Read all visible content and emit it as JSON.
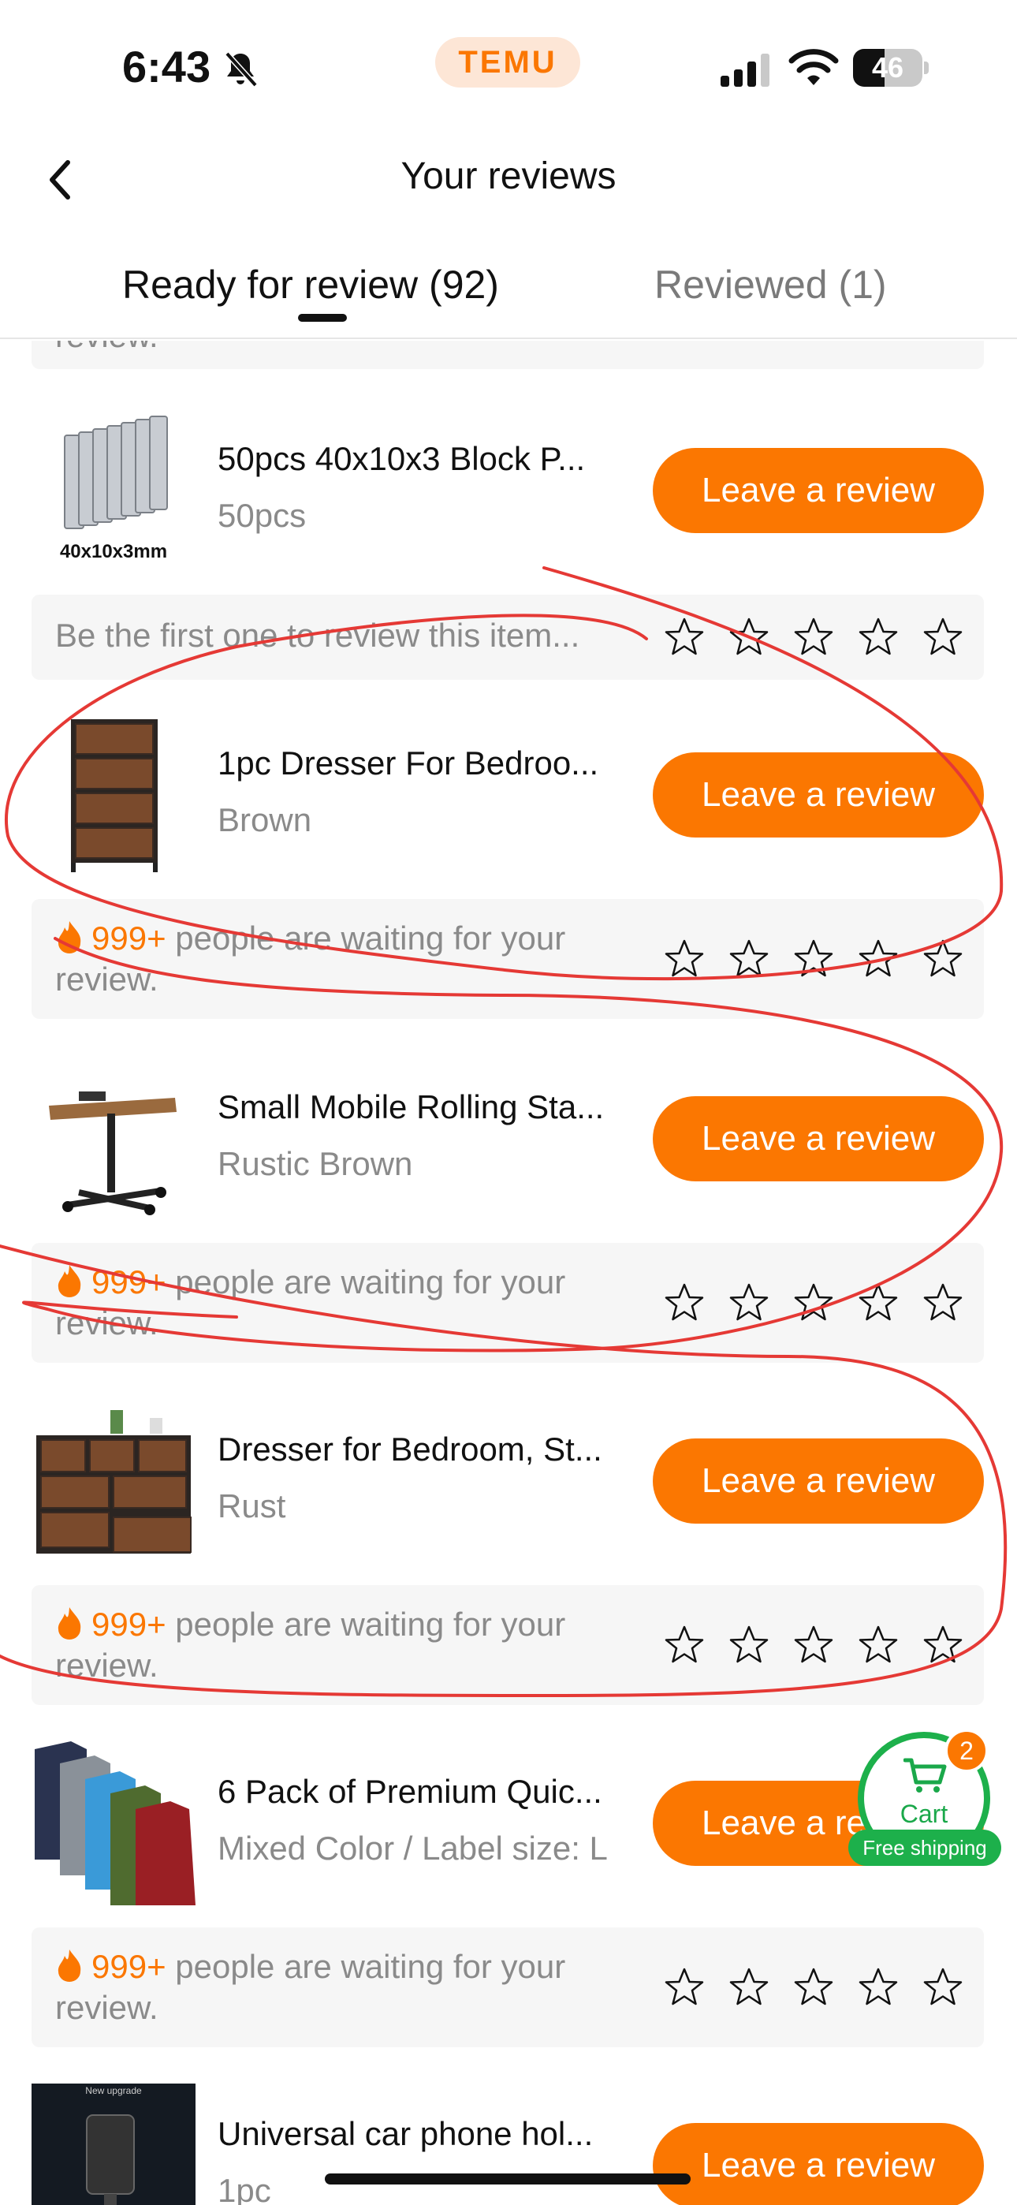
{
  "status_bar": {
    "time": "6:43",
    "battery_percent": "46",
    "battery_level": 0.46
  },
  "brand": "TEMU",
  "header": {
    "title": "Your reviews"
  },
  "tabs": [
    {
      "label": "Ready for review (92)",
      "active": true
    },
    {
      "label": "Reviewed (1)",
      "active": false
    }
  ],
  "top_prompt_partial": "review.",
  "items": [
    {
      "name": "50pcs 40x10x3 Block P...",
      "variant": "50pcs",
      "image_caption": "40x10x3mm",
      "button": "Leave a review",
      "prompt": {
        "text": "Be the first one to review this item...",
        "count": ""
      }
    },
    {
      "name": "1pc Dresser For Bedroo...",
      "variant": "Brown",
      "button": "Leave a review",
      "prompt": {
        "count": "999+",
        "text": "people are waiting for your review."
      }
    },
    {
      "name": "Small Mobile Rolling Sta...",
      "variant": "Rustic Brown",
      "button": "Leave a review",
      "prompt": {
        "count": "999+",
        "text": "people are waiting for your review."
      }
    },
    {
      "name": "Dresser for Bedroom, St...",
      "variant": "Rust",
      "button": "Leave a review",
      "prompt": {
        "count": "999+",
        "text": "people are waiting for your review."
      }
    },
    {
      "name": "6 Pack of Premium Quic...",
      "variant": "Mixed Color / Label size: L",
      "button": "Leave a review",
      "prompt": {
        "count": "999+",
        "text": "people are waiting for your review."
      }
    },
    {
      "name": "Universal car phone hol...",
      "variant": "1pc",
      "button": "Leave a review",
      "image_caption": "New upgrade"
    }
  ],
  "cart": {
    "label": "Cart",
    "badge": "2",
    "free_shipping": "Free shipping"
  },
  "colors": {
    "accent": "#fb7701",
    "green": "#1db04b",
    "annotation": "#e53935"
  },
  "icons": [
    "bell-slash-icon",
    "signal-icon",
    "wifi-icon",
    "battery-icon",
    "back-chevron-icon",
    "star-outline-icon",
    "flame-icon",
    "cart-icon"
  ]
}
